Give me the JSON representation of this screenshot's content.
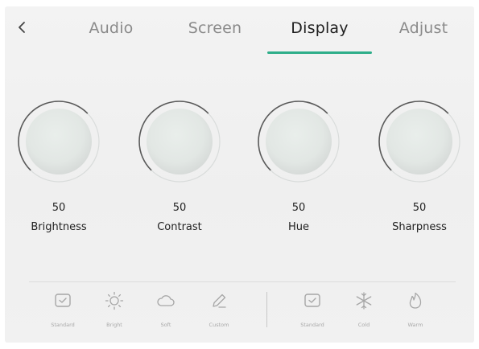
{
  "tabs": [
    {
      "label": "Audio",
      "active": false
    },
    {
      "label": "Screen",
      "active": false
    },
    {
      "label": "Display",
      "active": true
    },
    {
      "label": "Adjust",
      "active": false
    }
  ],
  "knobs": [
    {
      "label": "Brightness",
      "value": "50"
    },
    {
      "label": "Contrast",
      "value": "50"
    },
    {
      "label": "Hue",
      "value": "50"
    },
    {
      "label": "Sharpness",
      "value": "50"
    }
  ],
  "picture_modes": [
    {
      "label": "Standard",
      "icon": "standard-icon"
    },
    {
      "label": "Bright",
      "icon": "sun-icon"
    },
    {
      "label": "Soft",
      "icon": "cloud-icon"
    },
    {
      "label": "Custom",
      "icon": "pencil-icon"
    }
  ],
  "color_temperature": [
    {
      "label": "Standard",
      "icon": "standard-icon"
    },
    {
      "label": "Cold",
      "icon": "snowflake-icon"
    },
    {
      "label": "Warm",
      "icon": "flame-icon"
    }
  ],
  "colors": {
    "accent": "#2fae8a",
    "text": "#222222",
    "muted": "#8a8a8a"
  }
}
